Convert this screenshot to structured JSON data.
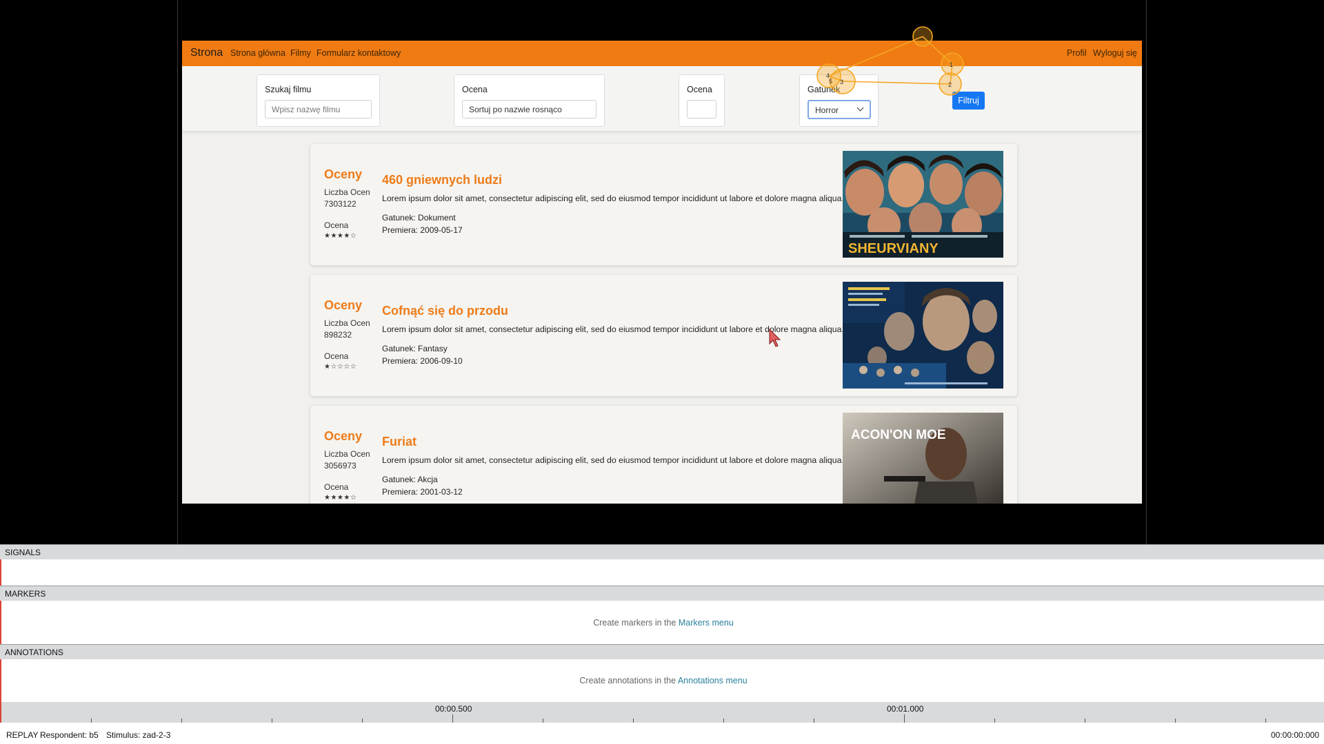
{
  "navbar": {
    "brand": "Strona",
    "links": [
      "Strona główna",
      "Filmy",
      "Formularz kontaktowy"
    ],
    "right_links": [
      "Profil",
      "Wyloguj się"
    ]
  },
  "filters": {
    "search_label": "Szukaj filmu",
    "search_placeholder": "Wpisz nazwę filmu",
    "sort_label": "Ocena",
    "sort_value": "Sortuj po nazwie rosnąco",
    "rating_label": "Ocena",
    "rating_value": "",
    "genre_label": "Gatunek",
    "genre_value": "Horror",
    "filter_button": "Filtruj"
  },
  "movies": [
    {
      "ratings_heading": "Oceny",
      "count_label": "Liczba Ocen",
      "count_value": "7303122",
      "rating_label": "Ocena",
      "stars": "★★★★☆",
      "title": "460 gniewnych ludzi",
      "description": "Lorem ipsum dolor sit amet, consectetur adipiscing elit, sed do eiusmod tempor incididunt ut labore et dolore magna aliqua.",
      "genre": "Gatunek: Dokument",
      "premiere": "Premiera: 2009-05-17",
      "poster_text": "SHEURVIANY"
    },
    {
      "ratings_heading": "Oceny",
      "count_label": "Liczba Ocen",
      "count_value": "898232",
      "rating_label": "Ocena",
      "stars": "★☆☆☆☆",
      "title": "Cofnąć się do przodu",
      "description": "Lorem ipsum dolor sit amet, consectetur adipiscing elit, sed do eiusmod tempor incididunt ut labore et dolore magna aliqua.",
      "genre": "Gatunek: Fantasy",
      "premiere": "Premiera: 2006-09-10",
      "poster_text": ""
    },
    {
      "ratings_heading": "Oceny",
      "count_label": "Liczba Ocen",
      "count_value": "3056973",
      "rating_label": "Ocena",
      "stars": "★★★★☆",
      "title": "Furiat",
      "description": "Lorem ipsum dolor sit amet, consectetur adipiscing elit, sed do eiusmod tempor incididunt ut labore et dolore magna aliqua.",
      "genre": "Gatunek: Akcja",
      "premiere": "Premiera: 2001-03-12",
      "poster_text": "ACON'ON MOE"
    }
  ],
  "gaze_points": [
    "1",
    "2",
    "3",
    "4",
    "5"
  ],
  "panels": {
    "signals": "SIGNALS",
    "markers": "MARKERS",
    "markers_msg": "Create markers in the ",
    "markers_link": "Markers menu",
    "annotations": "ANNOTATIONS",
    "annotations_msg": "Create annotations in the ",
    "annotations_link": "Annotations menu"
  },
  "timeline": {
    "label_1": "00:00.500",
    "label_2": "00:01.000"
  },
  "status": {
    "mode": "REPLAY",
    "respondent": "Respondent: b5",
    "stimulus": "Stimulus: zad-2-3",
    "time": "00:00:00:000"
  },
  "colors": {
    "navbar": "#f07b12",
    "accent_title": "#ee7b18",
    "filter_button": "#1677f2",
    "gaze": "#f5a623"
  }
}
